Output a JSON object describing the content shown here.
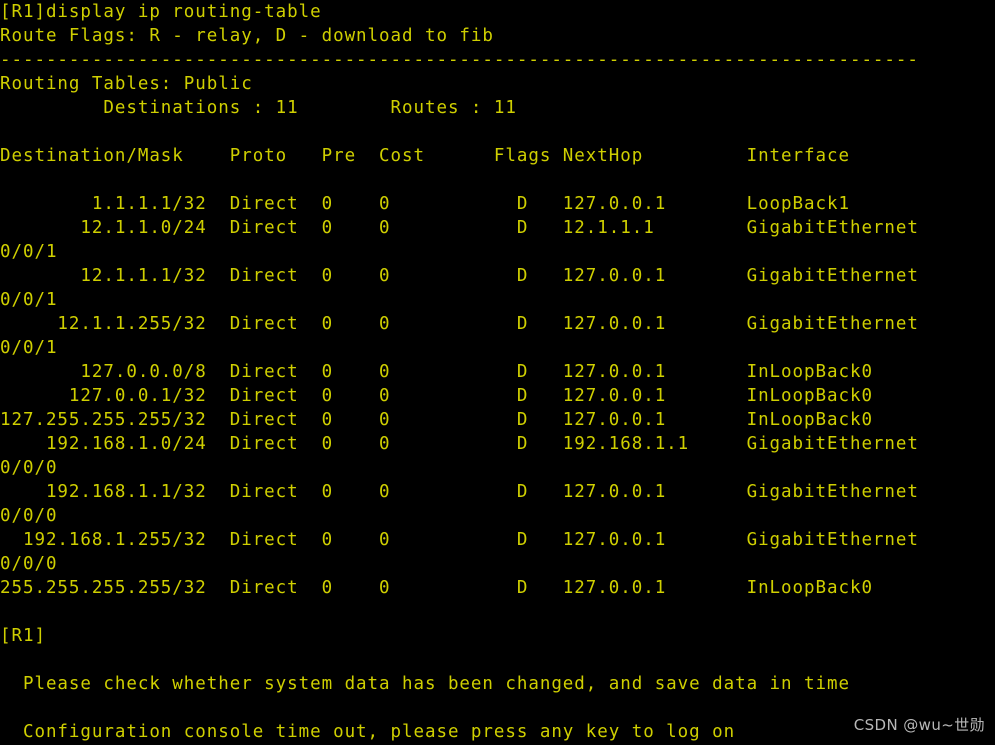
{
  "terminal": {
    "colors": {
      "background": "#000000",
      "foreground": "#cfcf00",
      "watermark": "#b8b8b8"
    },
    "prompt": "[R1]",
    "command": "display ip routing-table",
    "command_line": "[R1]display ip routing-table",
    "route_flags_line": "Route Flags: R - relay, D - download to fib",
    "separator": "--------------------------------------------------------------------------------",
    "routing_tables_line": "Routing Tables: Public",
    "summary_line": "         Destinations : 11        Routes : 11",
    "summary": {
      "destinations_label": "Destinations",
      "destinations_value": "11",
      "routes_label": "Routes",
      "routes_value": "11"
    },
    "header_line": "Destination/Mask    Proto   Pre  Cost      Flags NextHop         Interface",
    "columns": [
      "Destination/Mask",
      "Proto",
      "Pre",
      "Cost",
      "Flags",
      "NextHop",
      "Interface"
    ],
    "rows": [
      {
        "destination": "1.1.1.1/32",
        "proto": "Direct",
        "pre": "0",
        "cost": "0",
        "flags": "D",
        "nexthop": "127.0.0.1",
        "interface": "LoopBack1",
        "wrapped": "",
        "line": "        1.1.1.1/32  Direct  0    0           D   127.0.0.1       LoopBack1"
      },
      {
        "destination": "12.1.1.0/24",
        "proto": "Direct",
        "pre": "0",
        "cost": "0",
        "flags": "D",
        "nexthop": "12.1.1.1",
        "interface": "GigabitEthernet",
        "wrapped": "0/0/1",
        "line": "       12.1.1.0/24  Direct  0    0           D   12.1.1.1        GigabitEthernet"
      },
      {
        "destination": "12.1.1.1/32",
        "proto": "Direct",
        "pre": "0",
        "cost": "0",
        "flags": "D",
        "nexthop": "127.0.0.1",
        "interface": "GigabitEthernet",
        "wrapped": "0/0/1",
        "line": "       12.1.1.1/32  Direct  0    0           D   127.0.0.1       GigabitEthernet"
      },
      {
        "destination": "12.1.1.255/32",
        "proto": "Direct",
        "pre": "0",
        "cost": "0",
        "flags": "D",
        "nexthop": "127.0.0.1",
        "interface": "GigabitEthernet",
        "wrapped": "0/0/1",
        "line": "     12.1.1.255/32  Direct  0    0           D   127.0.0.1       GigabitEthernet"
      },
      {
        "destination": "127.0.0.0/8",
        "proto": "Direct",
        "pre": "0",
        "cost": "0",
        "flags": "D",
        "nexthop": "127.0.0.1",
        "interface": "InLoopBack0",
        "wrapped": "",
        "line": "       127.0.0.0/8  Direct  0    0           D   127.0.0.1       InLoopBack0"
      },
      {
        "destination": "127.0.0.1/32",
        "proto": "Direct",
        "pre": "0",
        "cost": "0",
        "flags": "D",
        "nexthop": "127.0.0.1",
        "interface": "InLoopBack0",
        "wrapped": "",
        "line": "      127.0.0.1/32  Direct  0    0           D   127.0.0.1       InLoopBack0"
      },
      {
        "destination": "127.255.255.255/32",
        "proto": "Direct",
        "pre": "0",
        "cost": "0",
        "flags": "D",
        "nexthop": "127.0.0.1",
        "interface": "InLoopBack0",
        "wrapped": "",
        "line": "127.255.255.255/32  Direct  0    0           D   127.0.0.1       InLoopBack0"
      },
      {
        "destination": "192.168.1.0/24",
        "proto": "Direct",
        "pre": "0",
        "cost": "0",
        "flags": "D",
        "nexthop": "192.168.1.1",
        "interface": "GigabitEthernet",
        "wrapped": "0/0/0",
        "line": "    192.168.1.0/24  Direct  0    0           D   192.168.1.1     GigabitEthernet"
      },
      {
        "destination": "192.168.1.1/32",
        "proto": "Direct",
        "pre": "0",
        "cost": "0",
        "flags": "D",
        "nexthop": "127.0.0.1",
        "interface": "GigabitEthernet",
        "wrapped": "0/0/0",
        "line": "    192.168.1.1/32  Direct  0    0           D   127.0.0.1       GigabitEthernet"
      },
      {
        "destination": "192.168.1.255/32",
        "proto": "Direct",
        "pre": "0",
        "cost": "0",
        "flags": "D",
        "nexthop": "127.0.0.1",
        "interface": "GigabitEthernet",
        "wrapped": "0/0/0",
        "line": "  192.168.1.255/32  Direct  0    0           D   127.0.0.1       GigabitEthernet"
      },
      {
        "destination": "255.255.255.255/32",
        "proto": "Direct",
        "pre": "0",
        "cost": "0",
        "flags": "D",
        "nexthop": "127.0.0.1",
        "interface": "InLoopBack0",
        "wrapped": "",
        "line": "255.255.255.255/32  Direct  0    0           D   127.0.0.1       InLoopBack0"
      }
    ],
    "trailing_prompt": "[R1]",
    "messages": [
      "  Please check whether system data has been changed, and save data in time",
      "  Configuration console time out, please press any key to log on"
    ]
  },
  "watermark": {
    "text": "CSDN @wu~世勋"
  }
}
